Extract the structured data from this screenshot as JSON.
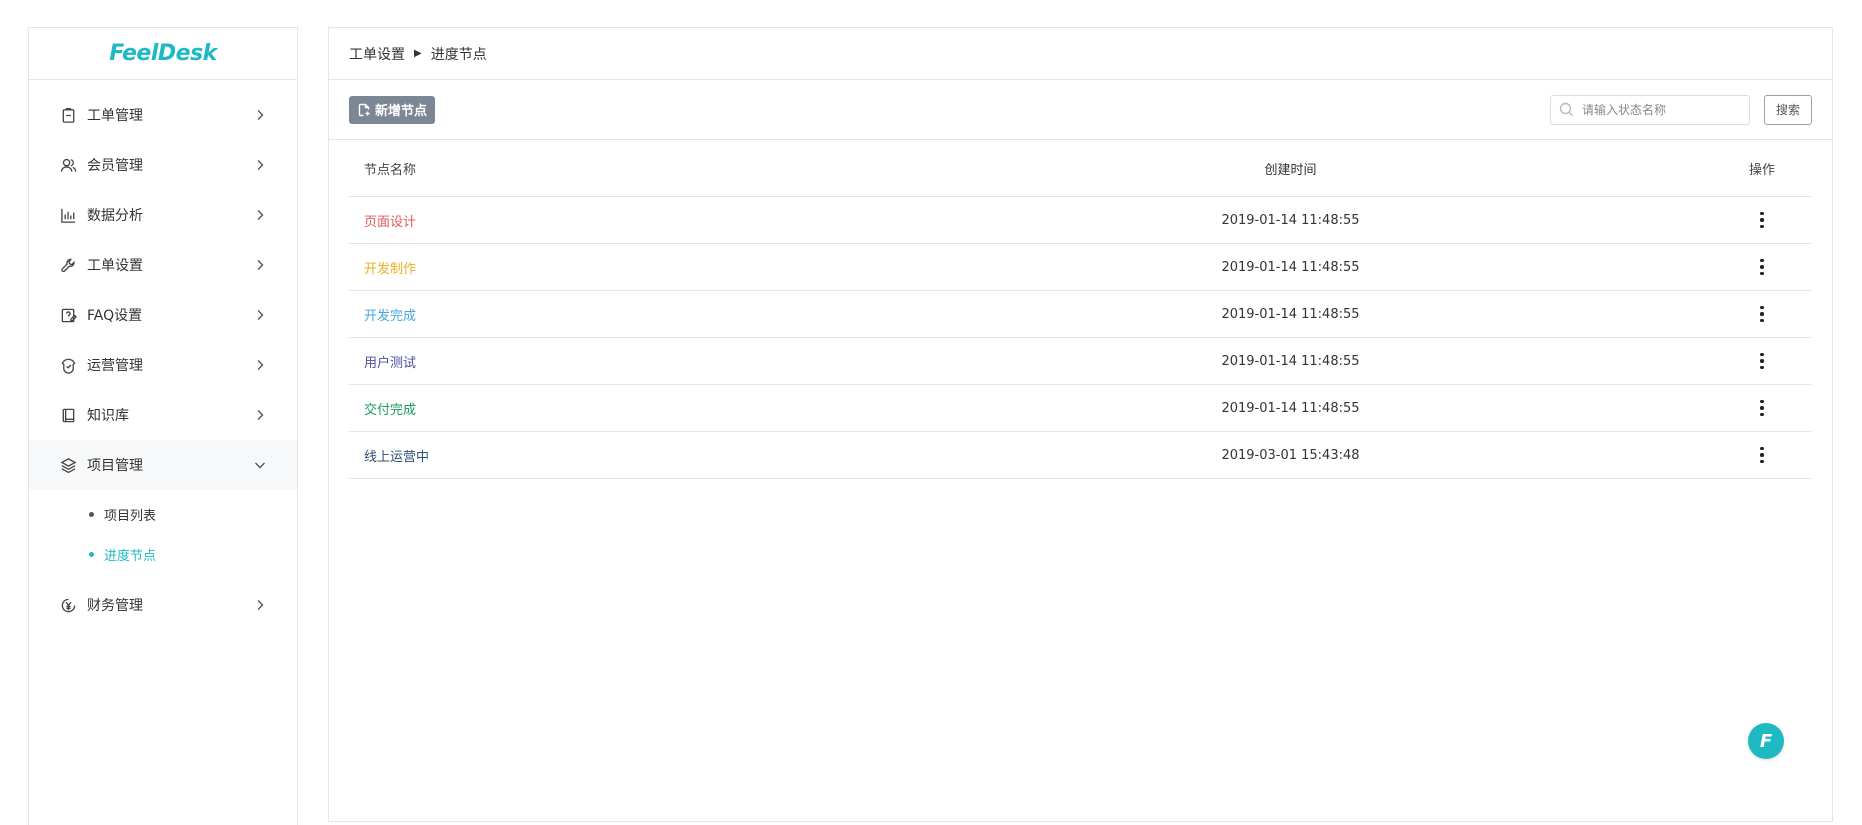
{
  "sidebar": {
    "logo": "FeelDesk",
    "items": [
      {
        "label": "工单管理",
        "icon": "ticket-icon"
      },
      {
        "label": "会员管理",
        "icon": "users-icon"
      },
      {
        "label": "数据分析",
        "icon": "bar-chart-icon"
      },
      {
        "label": "工单设置",
        "icon": "wrench-icon"
      },
      {
        "label": "FAQ设置",
        "icon": "faq-icon"
      },
      {
        "label": "运营管理",
        "icon": "operations-icon"
      },
      {
        "label": "知识库",
        "icon": "book-icon"
      },
      {
        "label": "项目管理",
        "icon": "layers-icon",
        "expanded": true,
        "children": [
          {
            "label": "项目列表",
            "active": false
          },
          {
            "label": "进度节点",
            "active": true
          }
        ]
      },
      {
        "label": "财务管理",
        "icon": "yen-icon"
      }
    ]
  },
  "breadcrumb": {
    "parent": "工单设置",
    "current": "进度节点"
  },
  "toolbar": {
    "add_label": "新增节点",
    "search_placeholder": "请输入状态名称",
    "search_label": "搜索"
  },
  "table": {
    "headers": {
      "name": "节点名称",
      "time": "创建时间",
      "op": "操作"
    },
    "rows": [
      {
        "name": "页面设计",
        "time": "2019-01-14 11:48:55",
        "color": "#e05a5a"
      },
      {
        "name": "开发制作",
        "time": "2019-01-14 11:48:55",
        "color": "#e8b021"
      },
      {
        "name": "开发完成",
        "time": "2019-01-14 11:48:55",
        "color": "#4aa6dc"
      },
      {
        "name": "用户测试",
        "time": "2019-01-14 11:48:55",
        "color": "#4b4f9e"
      },
      {
        "name": "交付完成",
        "time": "2019-01-14 11:48:55",
        "color": "#1a9b62"
      },
      {
        "name": "线上运营中",
        "time": "2019-03-01 15:43:48",
        "color": "#2f4f6f"
      }
    ]
  },
  "fab": {
    "label": "F"
  },
  "colors": {
    "accent": "#1fb9c3",
    "add_button": "#7d8694",
    "border": "#e6e6e6"
  }
}
